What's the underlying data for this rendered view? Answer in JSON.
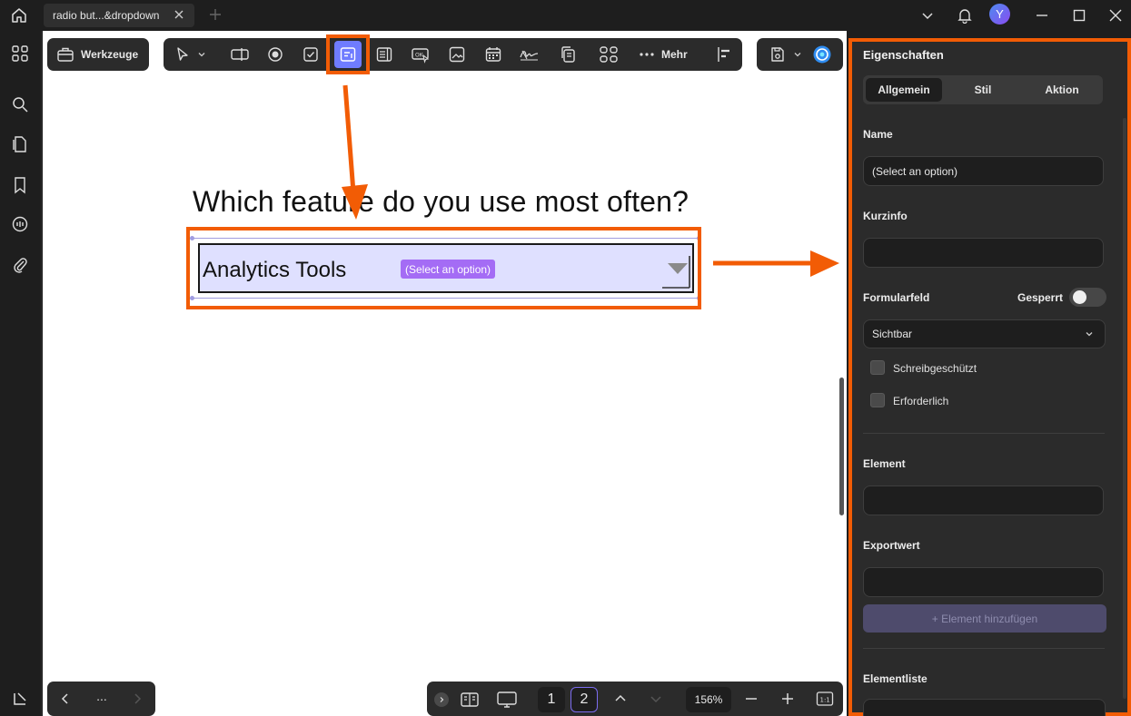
{
  "titlebar": {
    "tab_title": "radio but...&dropdown",
    "avatar_letter": "Y"
  },
  "toolbar": {
    "tools_label": "Werkzeuge",
    "more_label": "Mehr"
  },
  "document": {
    "question": "Which feature do you use most often?",
    "dropdown_value": "Analytics Tools",
    "dropdown_badge": "(Select an option)"
  },
  "bottombar": {
    "page_1": "1",
    "page_2": "2",
    "zoom": "156%",
    "more": "..."
  },
  "properties": {
    "title": "Eigenschaften",
    "tabs": [
      "Allgemein",
      "Stil",
      "Aktion"
    ],
    "name_label": "Name",
    "name_value": "(Select an option)",
    "tooltip_label": "Kurzinfo",
    "tooltip_value": "",
    "formfield_label": "Formularfeld",
    "locked_label": "Gesperrt",
    "visibility_value": "Sichtbar",
    "readonly_label": "Schreibgeschützt",
    "required_label": "Erforderlich",
    "element_label": "Element",
    "element_value": "",
    "export_label": "Exportwert",
    "export_value": "",
    "add_element_label": "+ Element hinzufügen",
    "elementlist_label": "Elementliste"
  },
  "colors": {
    "accent": "#6f7cff",
    "annotation": "#f25c05",
    "dropdown_fill": "#dfe0ff",
    "badge": "#a46cf5"
  }
}
